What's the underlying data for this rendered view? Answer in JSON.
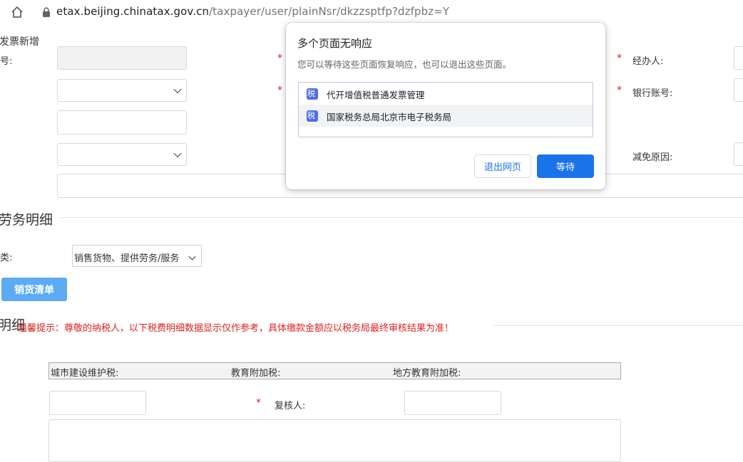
{
  "browser": {
    "url_host": "etax.beijing.chinatax.gov.cn",
    "url_path": "/taxpayer/user/plainNsr/dkzzsptfp?dzfpbz=Y"
  },
  "form": {
    "header_label": "发票新增",
    "id_label_partial": "号:",
    "agent_label": "经办人:",
    "bank_account_label": "银行账号:",
    "exemption_reason_label": "减免原因:",
    "required_mark": "*"
  },
  "services_section": {
    "title_partial": "劳务明细",
    "category_label_partial": "类:",
    "category_value": "销售货物、提供劳务/服务",
    "sales_list_button": "销货清单"
  },
  "tax_section": {
    "title_partial": "明细",
    "tip": "温馨提示：尊敬的纳税人，以下税费明细数据显示仅作参考，具体缴款金额应以税务局最终审核结果为准！",
    "headers": [
      "城市建设维护税:",
      "教育附加税:",
      "地方教育附加税:"
    ],
    "reviewer_label": "复核人:"
  },
  "dialog": {
    "title": "多个页面无响应",
    "message": "您可以等待这些页面恢复响应，也可以退出这些页面。",
    "pages": [
      "代开增值税普通发票管理",
      "国家税务总局北京市电子税务局"
    ],
    "exit_button": "退出网页",
    "wait_button": "等待",
    "favicon_icon": "tax-bureau-favicon-icon"
  }
}
